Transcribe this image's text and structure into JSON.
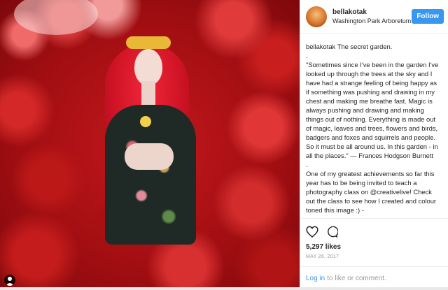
{
  "header": {
    "username": "bellakotak",
    "location": "Washington Park Arboretum",
    "follow_label": "Follow"
  },
  "caption": {
    "username": "bellakotak",
    "title": "The secret garden.",
    "dot1": ".",
    "quote": "\"Sometimes since I've been in the garden I've looked up through the trees at the sky and I have had a strange feeling of being happy as if something was pushing and drawing in my chest and making me breathe fast. Magic is always pushing and drawing and making things out of nothing. Everything is made out of magic, leaves and trees, flowers and birds, badgers and foxes and squirrels and people. So it must be all around us. In this garden - in all the places.\" — Frances Hodgson Burnett",
    "dot2": ".",
    "body": "One of my greatest achievements so far this year has to be being invited to teach a photography class on @creativelive! Check out the class to see how I created and colour toned this image :) -"
  },
  "actions": {
    "likes": "5,297 likes",
    "date": "MAY 26, 2017"
  },
  "login": {
    "link_label": "Log in",
    "suffix": "to like or comment."
  },
  "icons": {
    "like": "heart-icon",
    "comment": "comment-bubble-icon",
    "user_tag": "user-tag-icon"
  },
  "colors": {
    "accent": "#3897f0",
    "text": "#262626",
    "muted": "#999999"
  }
}
